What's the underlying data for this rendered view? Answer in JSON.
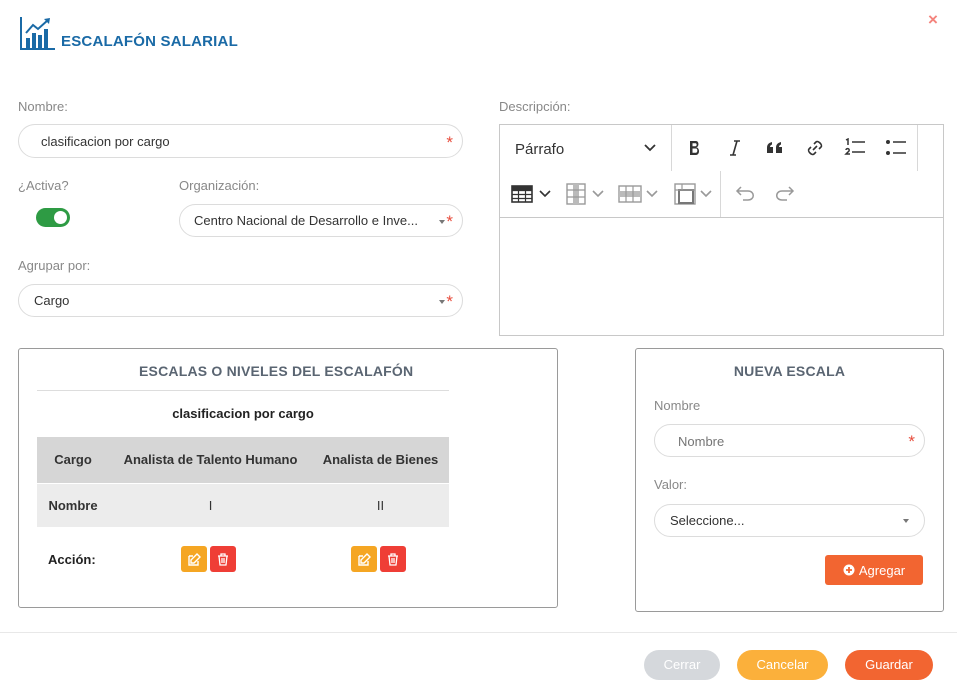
{
  "header": {
    "title": "ESCALAFÓN SALARIAL",
    "close_symbol": "×"
  },
  "form": {
    "nombre_label": "Nombre:",
    "nombre_value": "clasificacion por cargo",
    "activa_label": "¿Activa?",
    "activa_on": true,
    "organizacion_label": "Organización:",
    "organizacion_value": "Centro Nacional de Desarrollo e Inve...",
    "agrupar_label": "Agrupar por:",
    "agrupar_value": "Cargo",
    "descripcion_label": "Descripción:",
    "required_mark": "*"
  },
  "editor": {
    "paragraph_style": "Párrafo",
    "content": ""
  },
  "escalas": {
    "title": "ESCALAS O NIVELES DEL ESCALAFÓN",
    "subtitle": "clasificacion por cargo",
    "header_label": "Cargo",
    "columns": [
      "Analista de Talento Humano",
      "Analista de Bienes"
    ],
    "row_label": "Nombre",
    "row_values": [
      "I",
      "II"
    ],
    "action_label": "Acción:"
  },
  "nueva": {
    "title": "NUEVA ESCALA",
    "nombre_label": "Nombre",
    "nombre_placeholder": "Nombre",
    "valor_label": "Valor:",
    "valor_value": "Seleccione...",
    "agregar_label": "Agregar"
  },
  "footer": {
    "cerrar": "Cerrar",
    "cancelar": "Cancelar",
    "guardar": "Guardar"
  },
  "colors": {
    "accent_blue": "#1a6aa6",
    "toggle_green": "#2e9b44",
    "edit_yellow": "#f5a623",
    "delete_red": "#ef3e36",
    "agregar_orange": "#f26531",
    "cerrar_gray": "#d5d8dc",
    "cancelar_orange": "#fbb03b",
    "guardar_orange": "#f26531"
  }
}
